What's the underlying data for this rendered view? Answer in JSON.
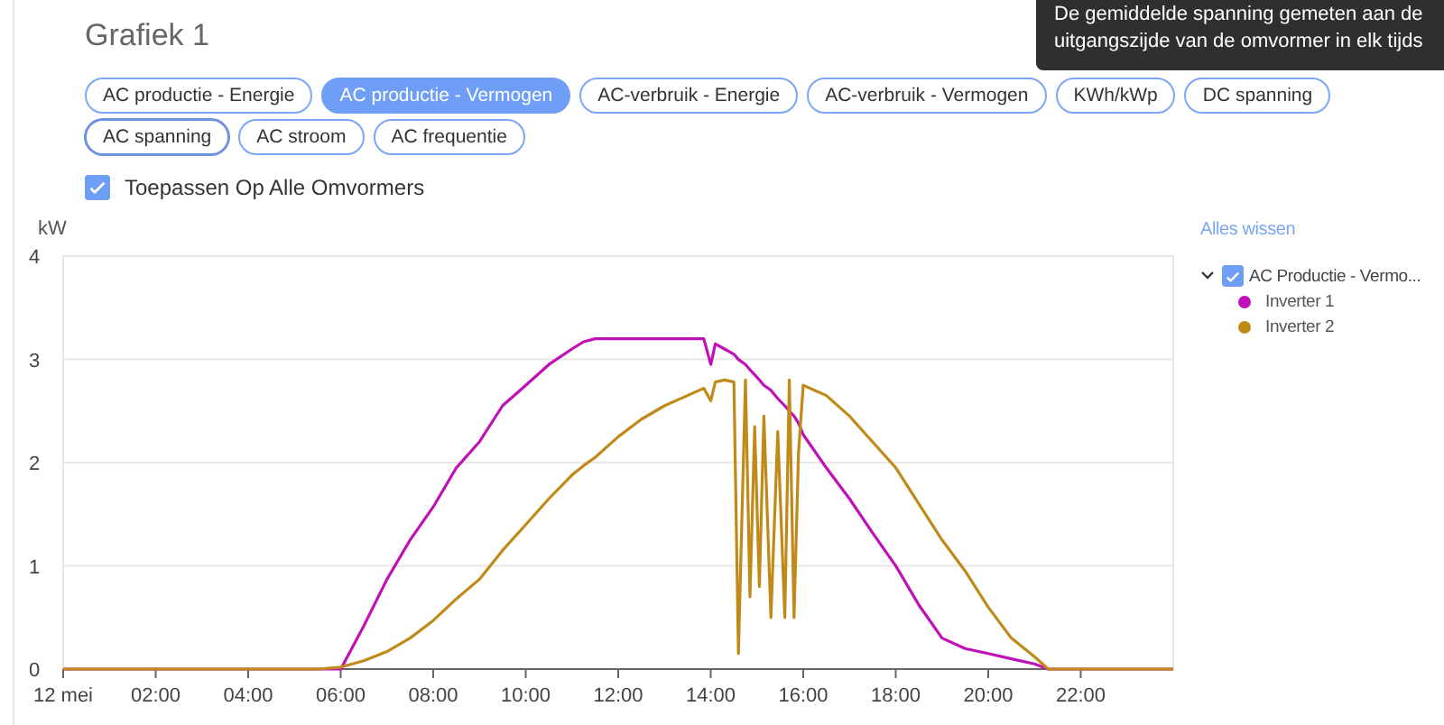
{
  "title": "Grafiek 1",
  "tooltip": {
    "lines": [
      "De gemiddelde spanning gemeten aan de",
      "uitgangszijde van de omvormer in elk tijds"
    ]
  },
  "chips": [
    {
      "label": "AC productie - Energie",
      "selected": false,
      "hovered": false
    },
    {
      "label": "AC productie - Vermogen",
      "selected": true,
      "hovered": false
    },
    {
      "label": "AC-verbruik - Energie",
      "selected": false,
      "hovered": false
    },
    {
      "label": "AC-verbruik - Vermogen",
      "selected": false,
      "hovered": false
    },
    {
      "label": "KWh/kWp",
      "selected": false,
      "hovered": false
    },
    {
      "label": "DC spanning",
      "selected": false,
      "hovered": false
    },
    {
      "label": "AC spanning",
      "selected": false,
      "hovered": true
    },
    {
      "label": "AC stroom",
      "selected": false,
      "hovered": false
    },
    {
      "label": "AC frequentie",
      "selected": false,
      "hovered": false
    }
  ],
  "axis_date": "12 mei",
  "apply_all": {
    "label": "Toepassen Op Alle Omvormers",
    "checked": true
  },
  "legend": {
    "clear_all": "Alles wissen",
    "groups": [
      {
        "label": "AC Productie - Vermo...",
        "checked": true,
        "expanded": true
      }
    ]
  },
  "chart_data": {
    "type": "line",
    "ylabel": "kW",
    "x": [
      0,
      5.5,
      6,
      6.5,
      7,
      7.5,
      8,
      8.5,
      9,
      9.5,
      10,
      10.5,
      11,
      11.25,
      11.5,
      12,
      12.5,
      13,
      13.5,
      13.85,
      14,
      14.1,
      14.3,
      14.5,
      14.6,
      14.75,
      14.85,
      14.95,
      15.05,
      15.15,
      15.3,
      15.45,
      15.6,
      15.7,
      15.8,
      15.9,
      16,
      16.5,
      17,
      17.5,
      18,
      18.5,
      19,
      19.5,
      20,
      20.5,
      21,
      21.3,
      24
    ],
    "series": [
      {
        "name": "Inverter 1",
        "color": "#c010b8",
        "values": [
          0,
          0,
          0,
          0.42,
          0.87,
          1.25,
          1.57,
          1.95,
          2.2,
          2.55,
          2.75,
          2.95,
          3.1,
          3.17,
          3.2,
          3.2,
          3.2,
          3.2,
          3.2,
          3.2,
          2.95,
          3.15,
          3.1,
          3.05,
          3.0,
          2.95,
          2.9,
          2.85,
          2.8,
          2.75,
          2.7,
          2.62,
          2.55,
          2.5,
          2.45,
          2.38,
          2.27,
          1.95,
          1.65,
          1.32,
          1.0,
          0.62,
          0.3,
          0.2,
          0.15,
          0.1,
          0.05,
          0,
          0
        ]
      },
      {
        "name": "Inverter 2",
        "color": "#c08a18",
        "values": [
          0,
          0,
          0.02,
          0.08,
          0.17,
          0.3,
          0.47,
          0.68,
          0.87,
          1.15,
          1.4,
          1.65,
          1.88,
          1.97,
          2.05,
          2.25,
          2.42,
          2.55,
          2.65,
          2.72,
          2.6,
          2.78,
          2.8,
          2.78,
          0.15,
          2.8,
          0.7,
          2.35,
          0.8,
          2.45,
          0.5,
          2.3,
          0.5,
          2.8,
          0.5,
          2.1,
          2.75,
          2.65,
          2.45,
          2.2,
          1.95,
          1.6,
          1.25,
          0.95,
          0.6,
          0.3,
          0.12,
          0,
          0
        ]
      }
    ],
    "xlim": [
      0,
      24
    ],
    "ylim": [
      0,
      4
    ],
    "grid": true,
    "xticks": [
      {
        "value": 2,
        "label": "02:00"
      },
      {
        "value": 4,
        "label": "04:00"
      },
      {
        "value": 6,
        "label": "06:00"
      },
      {
        "value": 8,
        "label": "08:00"
      },
      {
        "value": 10,
        "label": "10:00"
      },
      {
        "value": 12,
        "label": "12:00"
      },
      {
        "value": 14,
        "label": "14:00"
      },
      {
        "value": 16,
        "label": "16:00"
      },
      {
        "value": 18,
        "label": "18:00"
      },
      {
        "value": 20,
        "label": "20:00"
      },
      {
        "value": 22,
        "label": "22:00"
      }
    ],
    "yticks": [
      0,
      1,
      2,
      3,
      4
    ]
  }
}
